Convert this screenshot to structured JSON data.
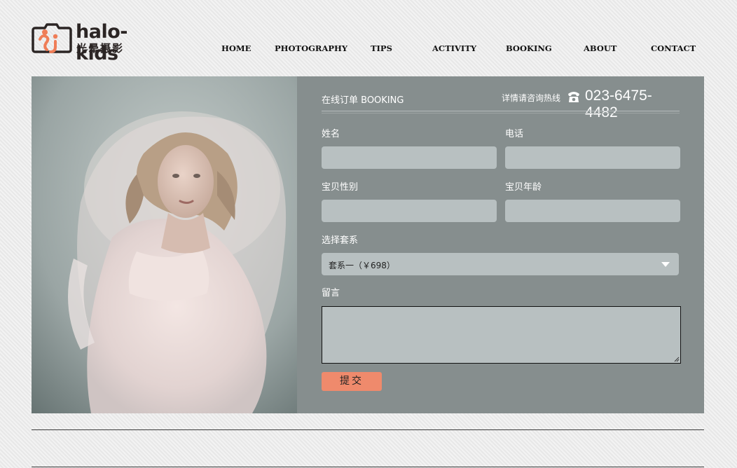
{
  "brand": {
    "name_prefix": "halo-k",
    "name_i": "i",
    "name_suffix": "ds",
    "subtitle": "光晕摄影",
    "accent_color": "#ef7d57"
  },
  "nav": {
    "items": [
      "HOME",
      "PHOTOGRAPHY",
      "TIPS",
      "ACTIVITY",
      "BOOKING",
      "ABOUT",
      "CONTACT"
    ]
  },
  "booking": {
    "title": "在线订单 BOOKING",
    "hotline_label": "详情请咨询热线",
    "hotline_number": "023-6475-4482",
    "phone_icon": "telephone-icon",
    "fields": {
      "name_label": "姓名",
      "phone_label": "电话",
      "gender_label": "宝贝性别",
      "age_label": "宝贝年龄",
      "package_label": "选择套系",
      "package_value": "套系一（￥698）",
      "message_label": "留言"
    },
    "submit_label": "提交"
  },
  "photo": {
    "subject": "child-in-tulle-dress-photo"
  },
  "colors": {
    "panel": "#868e8e",
    "field": "#b8c0c1",
    "button": "#ef8a6c"
  }
}
